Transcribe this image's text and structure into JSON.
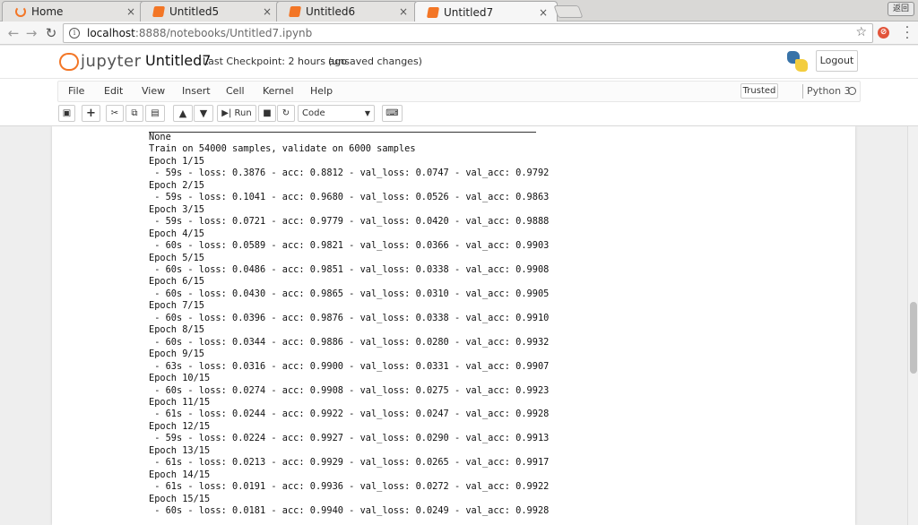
{
  "browser": {
    "tabs": [
      {
        "label": "Home",
        "icon": "jupyter-home-icon",
        "active": false
      },
      {
        "label": "Untitled5",
        "icon": "notebook-icon",
        "active": false
      },
      {
        "label": "Untitled6",
        "icon": "notebook-icon",
        "active": false
      },
      {
        "label": "Untitled7",
        "icon": "notebook-icon",
        "active": true
      }
    ],
    "close_glyph": "×",
    "window_button": "返回",
    "url_host": "localhost",
    "url_rest": ":8888/notebooks/Untitled7.ipynb"
  },
  "header": {
    "logo_text": "jupyter",
    "notebook_name": "Untitled7",
    "checkpoint": "Last Checkpoint: 2 hours ago",
    "unsaved": "(unsaved changes)",
    "logout_label": "Logout"
  },
  "menubar": {
    "items": [
      "File",
      "Edit",
      "View",
      "Insert",
      "Cell",
      "Kernel",
      "Help"
    ],
    "trusted_label": "Trusted",
    "kernel_name": "Python 3"
  },
  "toolbar": {
    "run_label": "Run",
    "cell_type": "Code"
  },
  "output": {
    "lines": [
      "None",
      "Train on 54000 samples, validate on 6000 samples",
      "Epoch 1/15",
      " - 59s - loss: 0.3876 - acc: 0.8812 - val_loss: 0.0747 - val_acc: 0.9792",
      "Epoch 2/15",
      " - 59s - loss: 0.1041 - acc: 0.9680 - val_loss: 0.0526 - val_acc: 0.9863",
      "Epoch 3/15",
      " - 59s - loss: 0.0721 - acc: 0.9779 - val_loss: 0.0420 - val_acc: 0.9888",
      "Epoch 4/15",
      " - 60s - loss: 0.0589 - acc: 0.9821 - val_loss: 0.0366 - val_acc: 0.9903",
      "Epoch 5/15",
      " - 60s - loss: 0.0486 - acc: 0.9851 - val_loss: 0.0338 - val_acc: 0.9908",
      "Epoch 6/15",
      " - 60s - loss: 0.0430 - acc: 0.9865 - val_loss: 0.0310 - val_acc: 0.9905",
      "Epoch 7/15",
      " - 60s - loss: 0.0396 - acc: 0.9876 - val_loss: 0.0338 - val_acc: 0.9910",
      "Epoch 8/15",
      " - 60s - loss: 0.0344 - acc: 0.9886 - val_loss: 0.0280 - val_acc: 0.9932",
      "Epoch 9/15",
      " - 63s - loss: 0.0316 - acc: 0.9900 - val_loss: 0.0331 - val_acc: 0.9907",
      "Epoch 10/15",
      " - 60s - loss: 0.0274 - acc: 0.9908 - val_loss: 0.0275 - val_acc: 0.9923",
      "Epoch 11/15",
      " - 61s - loss: 0.0244 - acc: 0.9922 - val_loss: 0.0247 - val_acc: 0.9928",
      "Epoch 12/15",
      " - 59s - loss: 0.0224 - acc: 0.9927 - val_loss: 0.0290 - val_acc: 0.9913",
      "Epoch 13/15",
      " - 61s - loss: 0.0213 - acc: 0.9929 - val_loss: 0.0265 - val_acc: 0.9917",
      "Epoch 14/15",
      " - 61s - loss: 0.0191 - acc: 0.9936 - val_loss: 0.0272 - val_acc: 0.9922",
      "Epoch 15/15",
      " - 60s - loss: 0.0181 - acc: 0.9940 - val_loss: 0.0249 - val_acc: 0.9928"
    ]
  },
  "colors": {
    "jupyter_orange": "#f37626",
    "python_blue": "#3873a8",
    "python_yellow": "#f3cd3e"
  }
}
